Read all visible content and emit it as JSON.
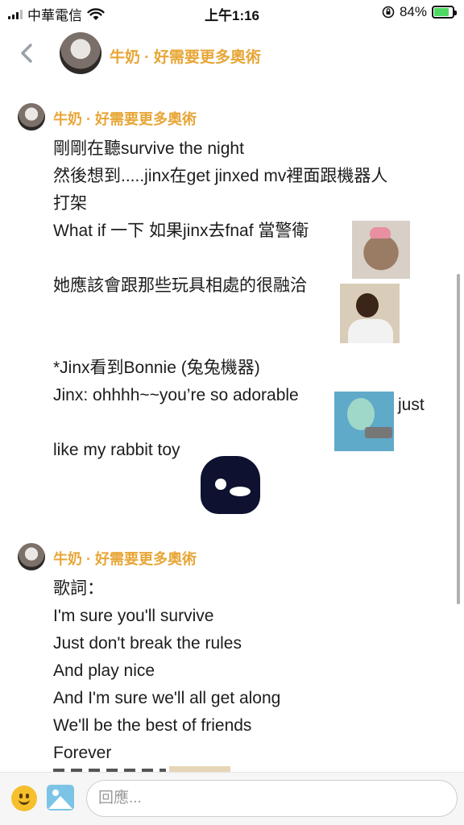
{
  "status_bar": {
    "carrier": "中華電信",
    "time": "上午1:16",
    "battery_percent": "84%",
    "battery_level": 0.84,
    "icons": [
      "signal-icon",
      "wifi-icon",
      "rotation-lock-icon",
      "battery-charging-icon"
    ]
  },
  "header": {
    "title": "牛奶 · 好需要更多奧術"
  },
  "messages": [
    {
      "author": "牛奶 · 好需要更多奧術",
      "lines": [
        "剛剛在聽survive the night",
        "然後想到.....jinx在get jinxed mv裡面跟機器人",
        "打架",
        "What if 一下 如果jinx去fnaf 當警衛",
        "",
        "她應該會跟那些玩具相處的很融洽",
        "",
        "",
        "*Jinx看到Bonnie (兔兔機器)",
        "Jinx: ohhhh~~you’re so adorable",
        "just",
        "",
        "like my rabbit toy"
      ]
    },
    {
      "author": "牛奶 · 好需要更多奧術",
      "lines": [
        "歌詞：",
        "I'm sure you'll survive",
        "Just don't break the rules",
        "And play nice",
        "And I'm sure we'll all get along",
        "We'll be the best of friends",
        "Forever"
      ]
    }
  ],
  "composer": {
    "placeholder": "回應..."
  },
  "colors": {
    "accent": "#e8a637",
    "text": "#1c1c1c",
    "bar_bg": "#f6f6f6"
  }
}
